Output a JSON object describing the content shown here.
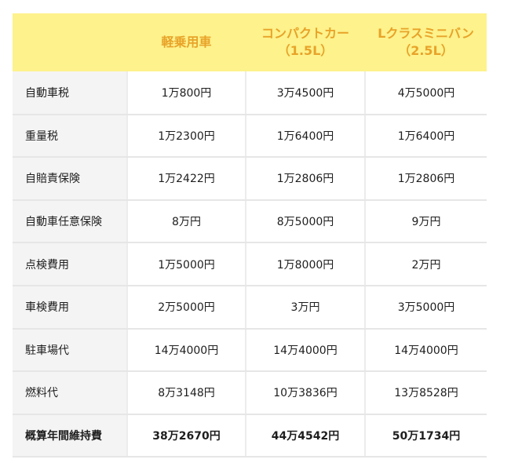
{
  "header": {
    "col0": "",
    "col1_line1": "軽乗用車",
    "col2_line1": "コンパクトカー",
    "col2_line2": "（1.5L）",
    "col3_line1": "Lクラスミニバン",
    "col3_line2": "（2.5L）"
  },
  "rows": [
    {
      "label": "自動車税",
      "kei": "1万800円",
      "compact": "3万4500円",
      "minivan": "4万5000円"
    },
    {
      "label": "重量税",
      "kei": "1万2300円",
      "compact": "1万6400円",
      "minivan": "1万6400円"
    },
    {
      "label": "自賠責保険",
      "kei": "1万2422円",
      "compact": "1万2806円",
      "minivan": "1万2806円"
    },
    {
      "label": "自動車任意保険",
      "kei": "8万円",
      "compact": "8万5000円",
      "minivan": "9万円"
    },
    {
      "label": "点検費用",
      "kei": "1万5000円",
      "compact": "1万8000円",
      "minivan": "2万円"
    },
    {
      "label": "車検費用",
      "kei": "2万5000円",
      "compact": "3万円",
      "minivan": "3万5000円"
    },
    {
      "label": "駐車場代",
      "kei": "14万4000円",
      "compact": "14万4000円",
      "minivan": "14万4000円"
    },
    {
      "label": "燃料代",
      "kei": "8万3148円",
      "compact": "10万3836円",
      "minivan": "13万8528円"
    },
    {
      "label": "概算年間維持費",
      "kei": "38万2670円",
      "compact": "44万4542円",
      "minivan": "50万1734円"
    }
  ],
  "colors": {
    "header_bg": "#fdf28c",
    "header_text": "#e8a329",
    "label_bg": "#f4f4f4",
    "divider": "#e6e6e6"
  }
}
